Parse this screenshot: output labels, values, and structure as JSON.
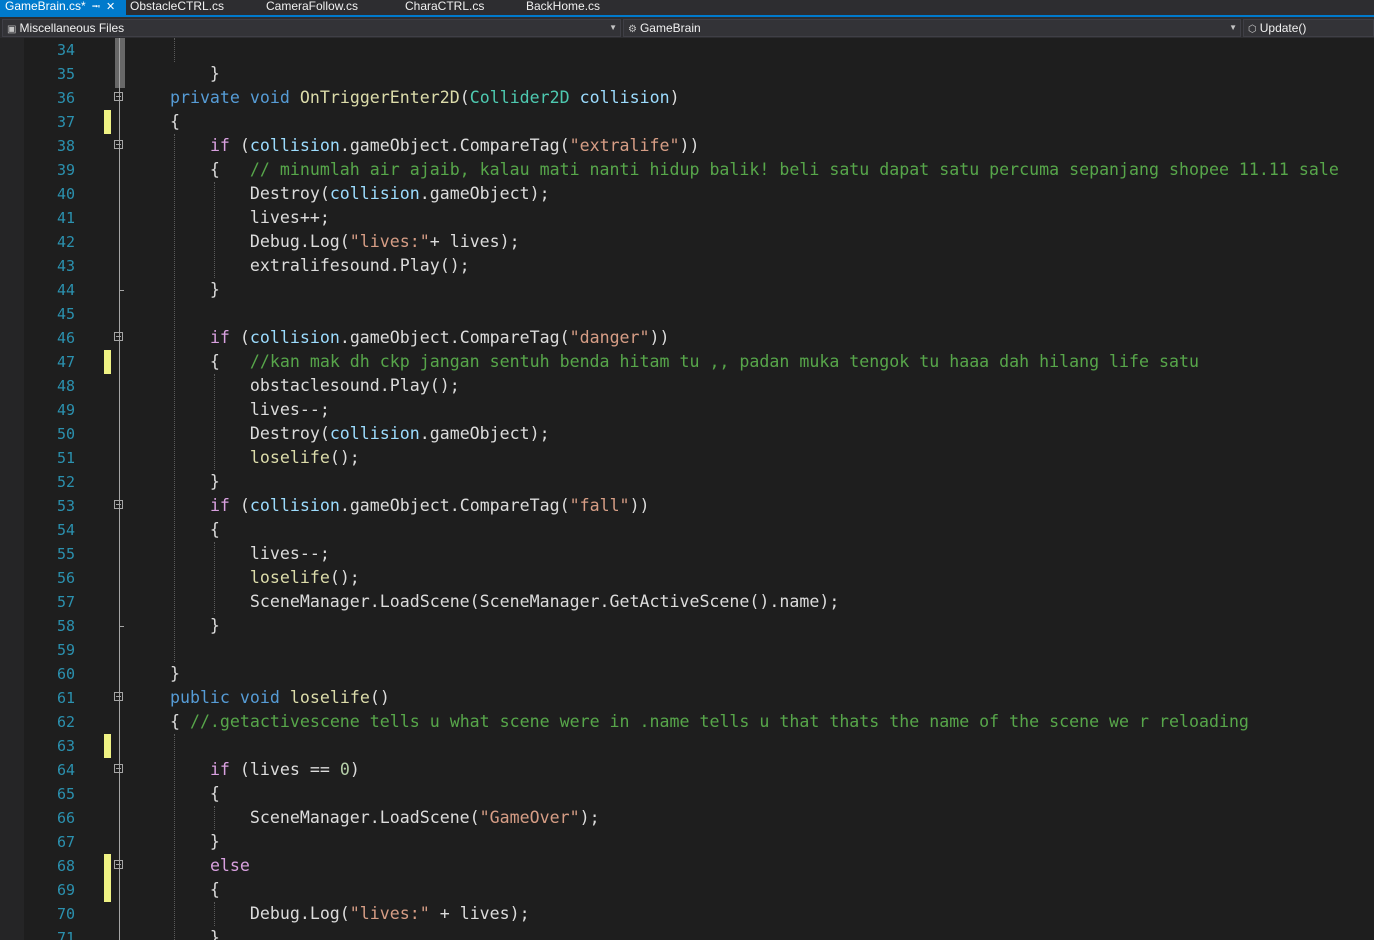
{
  "tabs": [
    {
      "label": "GameBrain.cs*",
      "active": true
    },
    {
      "label": "ObstacleCTRL.cs",
      "active": false
    },
    {
      "label": "CameraFollow.cs",
      "active": false
    },
    {
      "label": "CharaCTRL.cs",
      "active": false
    },
    {
      "label": "BackHome.cs",
      "active": false
    }
  ],
  "navbar": {
    "project": "Miscellaneous Files",
    "type": "GameBrain",
    "member": "Update()"
  },
  "colors": {
    "accent": "#007acc",
    "change_marker": "#eff284",
    "keyword": "#569cd6",
    "control_keyword": "#d8a0df",
    "string": "#d69d85",
    "comment": "#57a64a",
    "line_number": "#2b91af"
  },
  "editor": {
    "lines": [
      {
        "num": "34",
        "code": ""
      },
      {
        "num": "35",
        "code": "        }"
      },
      {
        "num": "36",
        "code": "    private void OnTriggerEnter2D(Collider2D collision)"
      },
      {
        "num": "37",
        "code": "    {"
      },
      {
        "num": "38",
        "code": "        if (collision.gameObject.CompareTag(\"extralife\"))"
      },
      {
        "num": "39",
        "code": "        {   // minumlah air ajaib, kalau mati nanti hidup balik! beli satu dapat satu percuma sepanjang shopee 11.11 sale"
      },
      {
        "num": "40",
        "code": "            Destroy(collision.gameObject);"
      },
      {
        "num": "41",
        "code": "            lives++;"
      },
      {
        "num": "42",
        "code": "            Debug.Log(\"lives:\"+ lives);"
      },
      {
        "num": "43",
        "code": "            extralifesound.Play();"
      },
      {
        "num": "44",
        "code": "        }"
      },
      {
        "num": "45",
        "code": ""
      },
      {
        "num": "46",
        "code": "        if (collision.gameObject.CompareTag(\"danger\"))"
      },
      {
        "num": "47",
        "code": "        {   //kan mak dh ckp jangan sentuh benda hitam tu ,, padan muka tengok tu haaa dah hilang life satu"
      },
      {
        "num": "48",
        "code": "            obstaclesound.Play();"
      },
      {
        "num": "49",
        "code": "            lives--;"
      },
      {
        "num": "50",
        "code": "            Destroy(collision.gameObject);"
      },
      {
        "num": "51",
        "code": "            loselife();"
      },
      {
        "num": "52",
        "code": "        }"
      },
      {
        "num": "53",
        "code": "        if (collision.gameObject.CompareTag(\"fall\"))"
      },
      {
        "num": "54",
        "code": "        {"
      },
      {
        "num": "55",
        "code": "            lives--;"
      },
      {
        "num": "56",
        "code": "            loselife();"
      },
      {
        "num": "57",
        "code": "            SceneManager.LoadScene(SceneManager.GetActiveScene().name);"
      },
      {
        "num": "58",
        "code": "        }"
      },
      {
        "num": "59",
        "code": ""
      },
      {
        "num": "60",
        "code": "    }"
      },
      {
        "num": "61",
        "code": "    public void loselife()"
      },
      {
        "num": "62",
        "code": "    { //.getactivescene tells u what scene were in .name tells u that thats the name of the scene we r reloading"
      },
      {
        "num": "63",
        "code": ""
      },
      {
        "num": "64",
        "code": "        if (lives == 0)"
      },
      {
        "num": "65",
        "code": "        {"
      },
      {
        "num": "66",
        "code": "            SceneManager.LoadScene(\"GameOver\");"
      },
      {
        "num": "67",
        "code": "        }"
      },
      {
        "num": "68",
        "code": "        else"
      },
      {
        "num": "69",
        "code": "        {"
      },
      {
        "num": "70",
        "code": "            Debug.Log(\"lives:\" + lives);"
      },
      {
        "num": "71",
        "code": "        }"
      }
    ]
  }
}
